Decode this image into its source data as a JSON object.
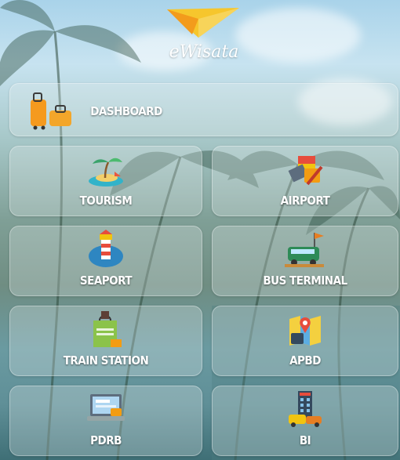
{
  "app": {
    "title": "eWisata"
  },
  "menu": {
    "dashboard": "DASHBOARD",
    "tourism": "TOURISM",
    "airport": "AIRPORT",
    "seaport": "SEAPORT",
    "bus_terminal": "BUS TERMINAL",
    "train_station": "TRAIN STATION",
    "apbd": "APBD",
    "pdrb": "PDRB",
    "bi": "BI"
  },
  "icons": {
    "logo": "paper-plane-logo",
    "dashboard": "luggage-icon",
    "tourism": "island-icon",
    "airport": "airport-icon",
    "seaport": "lighthouse-icon",
    "bus_terminal": "bus-icon",
    "train_station": "duty-free-bag-icon",
    "apbd": "map-wallet-icon",
    "pdrb": "laptop-icon",
    "bi": "bank-building-icon"
  },
  "colors": {
    "label": "#ffffff",
    "logo_yellow": "#f6c62d",
    "logo_orange": "#f39b1c"
  }
}
